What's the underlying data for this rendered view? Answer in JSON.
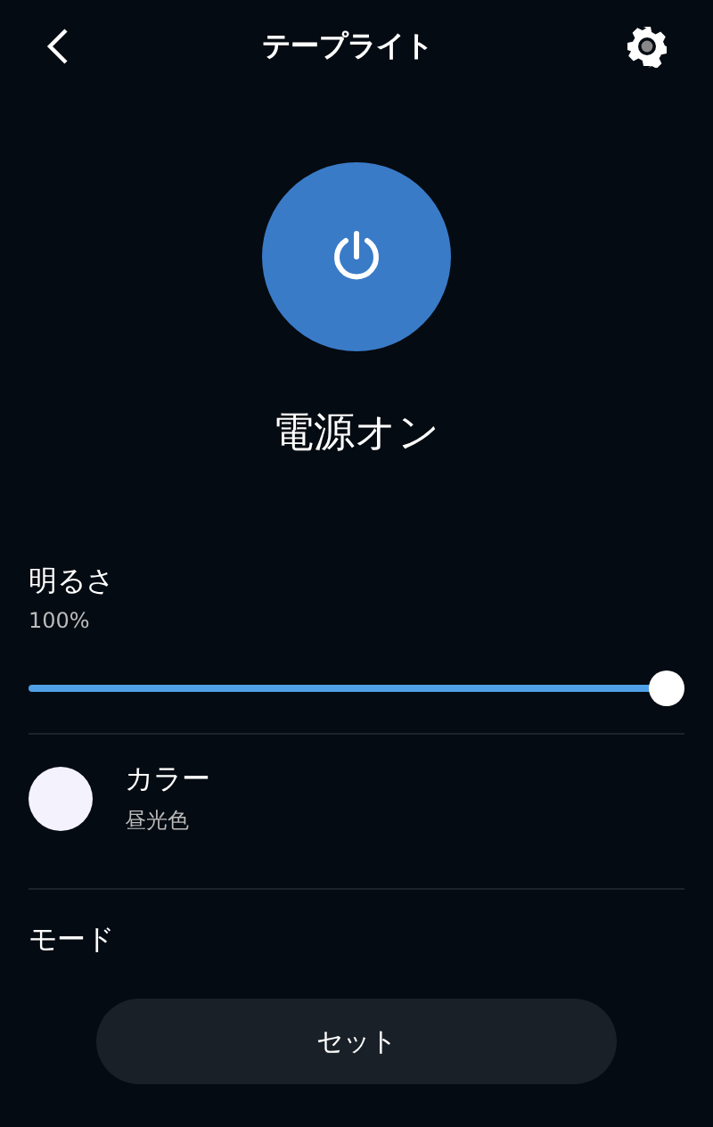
{
  "header": {
    "title": "テープライト"
  },
  "power": {
    "on": true,
    "label": "電源オン"
  },
  "brightness": {
    "label": "明るさ",
    "reading": "100%",
    "level": 1.0
  },
  "color": {
    "label": "カラー",
    "value": "昼光色",
    "color": "#f4f2fc"
  },
  "mode": {
    "label": "モード"
  },
  "set_button": {
    "label": "セット"
  }
}
